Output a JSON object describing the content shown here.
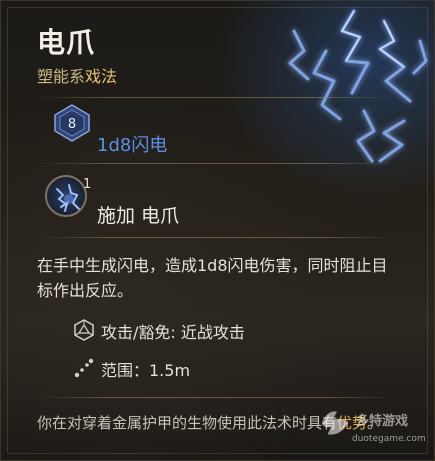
{
  "spell": {
    "title": "电爪",
    "school_prefix": "塑能系",
    "school_type": "戏法",
    "dice_face": "8",
    "damage": "1d8闪电",
    "count": "1",
    "apply_label": "施加 电爪",
    "description": "在手中生成闪电，造成1d8闪电伤害，同时阻止目标作出反应。",
    "attack_label": "攻击/豁免: 近战攻击",
    "range_label": "范围：1.5m",
    "footer_prefix": "你在对穿着金属护甲的生物使用此法术时具有",
    "footer_advantage": "优势",
    "footer_suffix": "。"
  },
  "watermark": {
    "text": "多特游戏",
    "url": "duotegame.com"
  },
  "colors": {
    "title": "#f2eee6",
    "school": "#c9b784",
    "accent": "#e6c36a",
    "damage": "#5b8fe6",
    "advantage": "#e0a84a",
    "lightning": "#8fb6ff"
  },
  "icons": {
    "dice": "d8-dice-icon",
    "spell": "shocking-grasp-spell-icon",
    "attack": "d20-dice-icon",
    "range": "range-dots-icon"
  }
}
